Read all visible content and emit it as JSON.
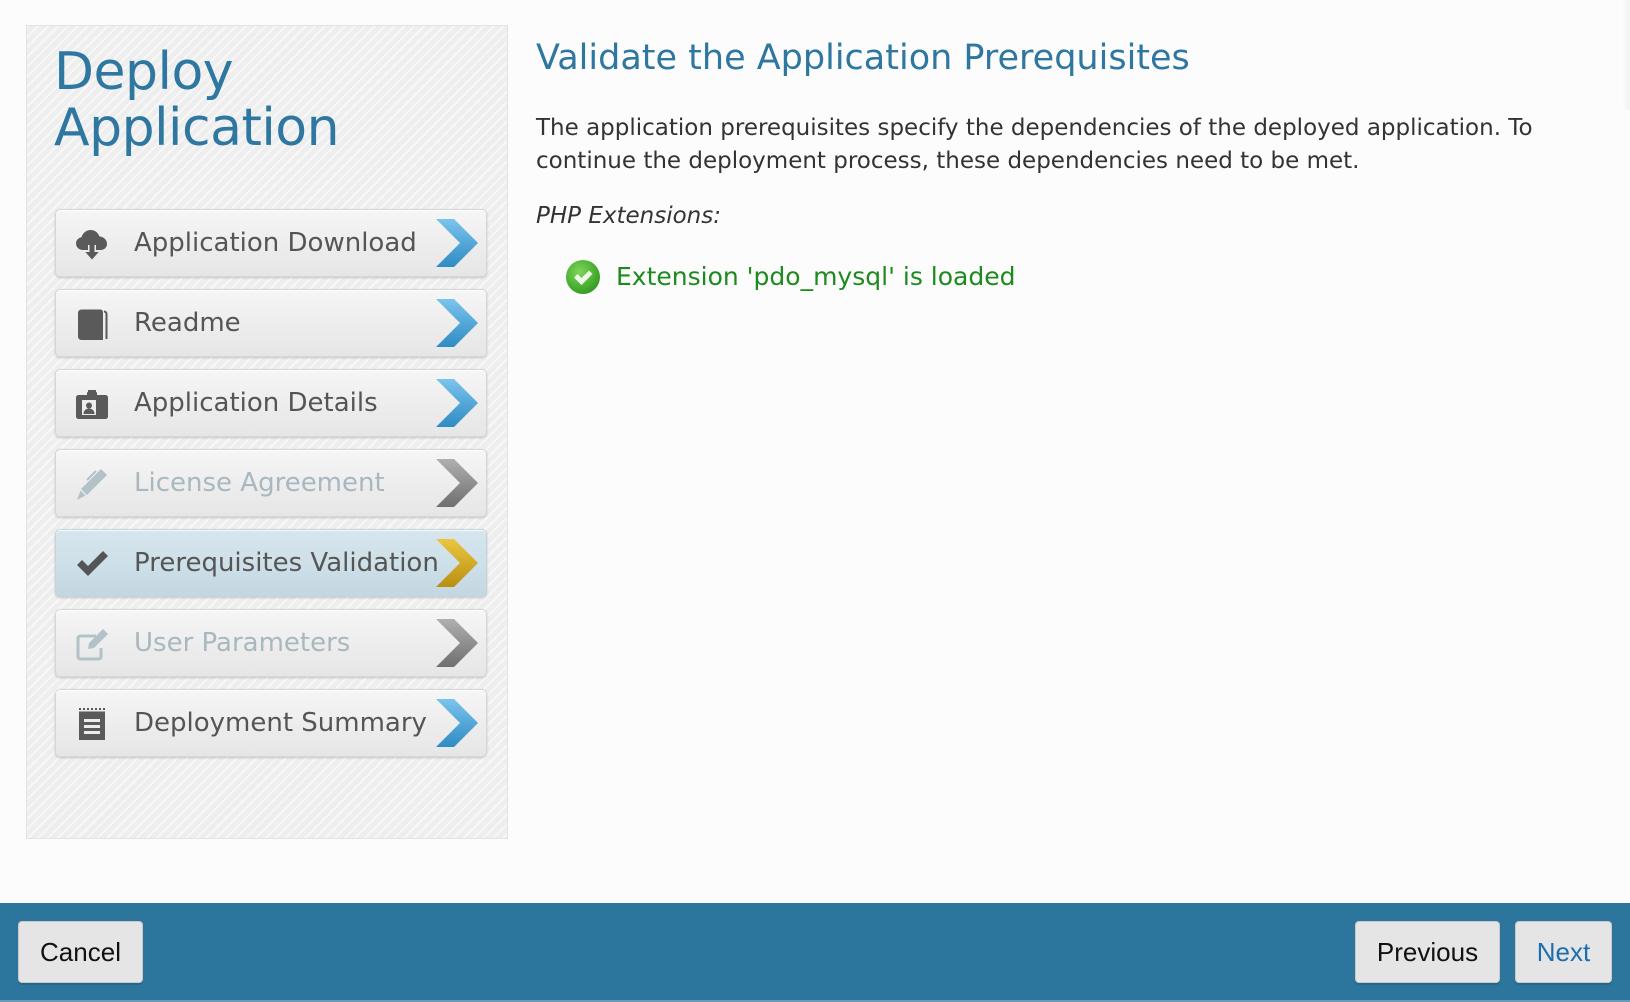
{
  "sidebar": {
    "title_line1": "Deploy",
    "title_line2": "Application",
    "steps": [
      {
        "label": "Application Download",
        "icon": "cloud-download-icon",
        "state": "completed"
      },
      {
        "label": "Readme",
        "icon": "book-icon",
        "state": "completed"
      },
      {
        "label": "Application Details",
        "icon": "id-badge-icon",
        "state": "completed"
      },
      {
        "label": "License Agreement",
        "icon": "pen-icon",
        "state": "disabled"
      },
      {
        "label": "Prerequisites Validation",
        "icon": "checkmark-icon",
        "state": "active"
      },
      {
        "label": "User Parameters",
        "icon": "edit-icon",
        "state": "disabled"
      },
      {
        "label": "Deployment Summary",
        "icon": "notepad-icon",
        "state": "completed"
      }
    ]
  },
  "main": {
    "title": "Validate the Application Prerequisites",
    "description": "The application prerequisites specify the dependencies of the deployed application. To continue the deployment process, these dependencies need to be met.",
    "sections": [
      {
        "label": "PHP Extensions:",
        "checks": [
          {
            "status": "passed",
            "icon": "green-check-circle-icon",
            "text": "Extension 'pdo_mysql' is loaded"
          }
        ]
      }
    ]
  },
  "footer": {
    "cancel_label": "Cancel",
    "previous_label": "Previous",
    "next_label": "Next"
  },
  "colors": {
    "accent_blue": "#2e77a0",
    "footer_bar": "#2c759d",
    "chevron_completed": "#4aa3d8",
    "chevron_active": "#d4a81e",
    "chevron_disabled": "#8c8c8c",
    "success_text": "#1d8a1d"
  }
}
